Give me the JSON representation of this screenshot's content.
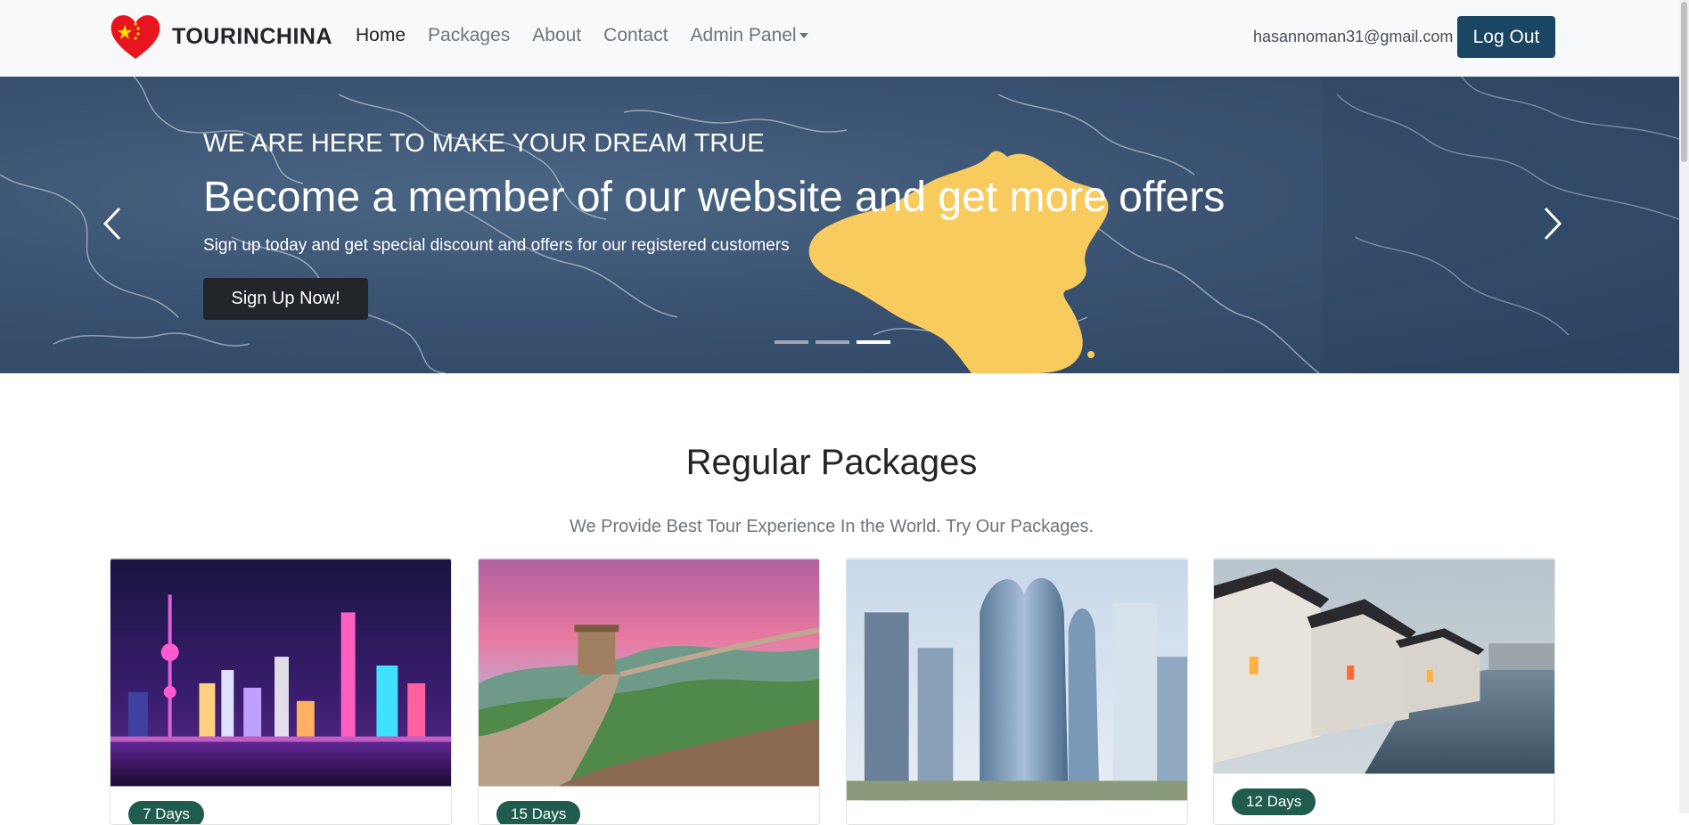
{
  "navbar": {
    "brand": "TOURINCHINA",
    "links": [
      {
        "label": "Home",
        "active": true
      },
      {
        "label": "Packages",
        "active": false
      },
      {
        "label": "About",
        "active": false
      },
      {
        "label": "Contact",
        "active": false
      },
      {
        "label": "Admin Panel",
        "active": false
      }
    ],
    "user_email": "hasannoman31@gmail.com",
    "logout_label": "Log Out"
  },
  "hero": {
    "kicker": "WE ARE HERE TO MAKE YOUR DREAM TRUE",
    "title": "Become a member of our website and get more offers",
    "subtitle": "Sign up today and get special discount and offers for our registered customers",
    "cta_label": "Sign Up Now!",
    "active_slide": 3,
    "slide_count": 3
  },
  "section": {
    "title": "Regular Packages",
    "subtitle": "We Provide Best Tour Experience In the World. Try Our Packages."
  },
  "packages": [
    {
      "duration": "7 Days",
      "scene": "shanghai-night-skyline"
    },
    {
      "duration": "15 Days",
      "scene": "great-wall"
    },
    {
      "duration": "",
      "scene": "modern-towers"
    },
    {
      "duration": "12 Days",
      "scene": "water-town"
    }
  ],
  "colors": {
    "primary_dark": "#1a4663",
    "badge": "#1f5c4e",
    "china_yellow": "#f7cb5e",
    "heart_red": "#e8141e"
  }
}
